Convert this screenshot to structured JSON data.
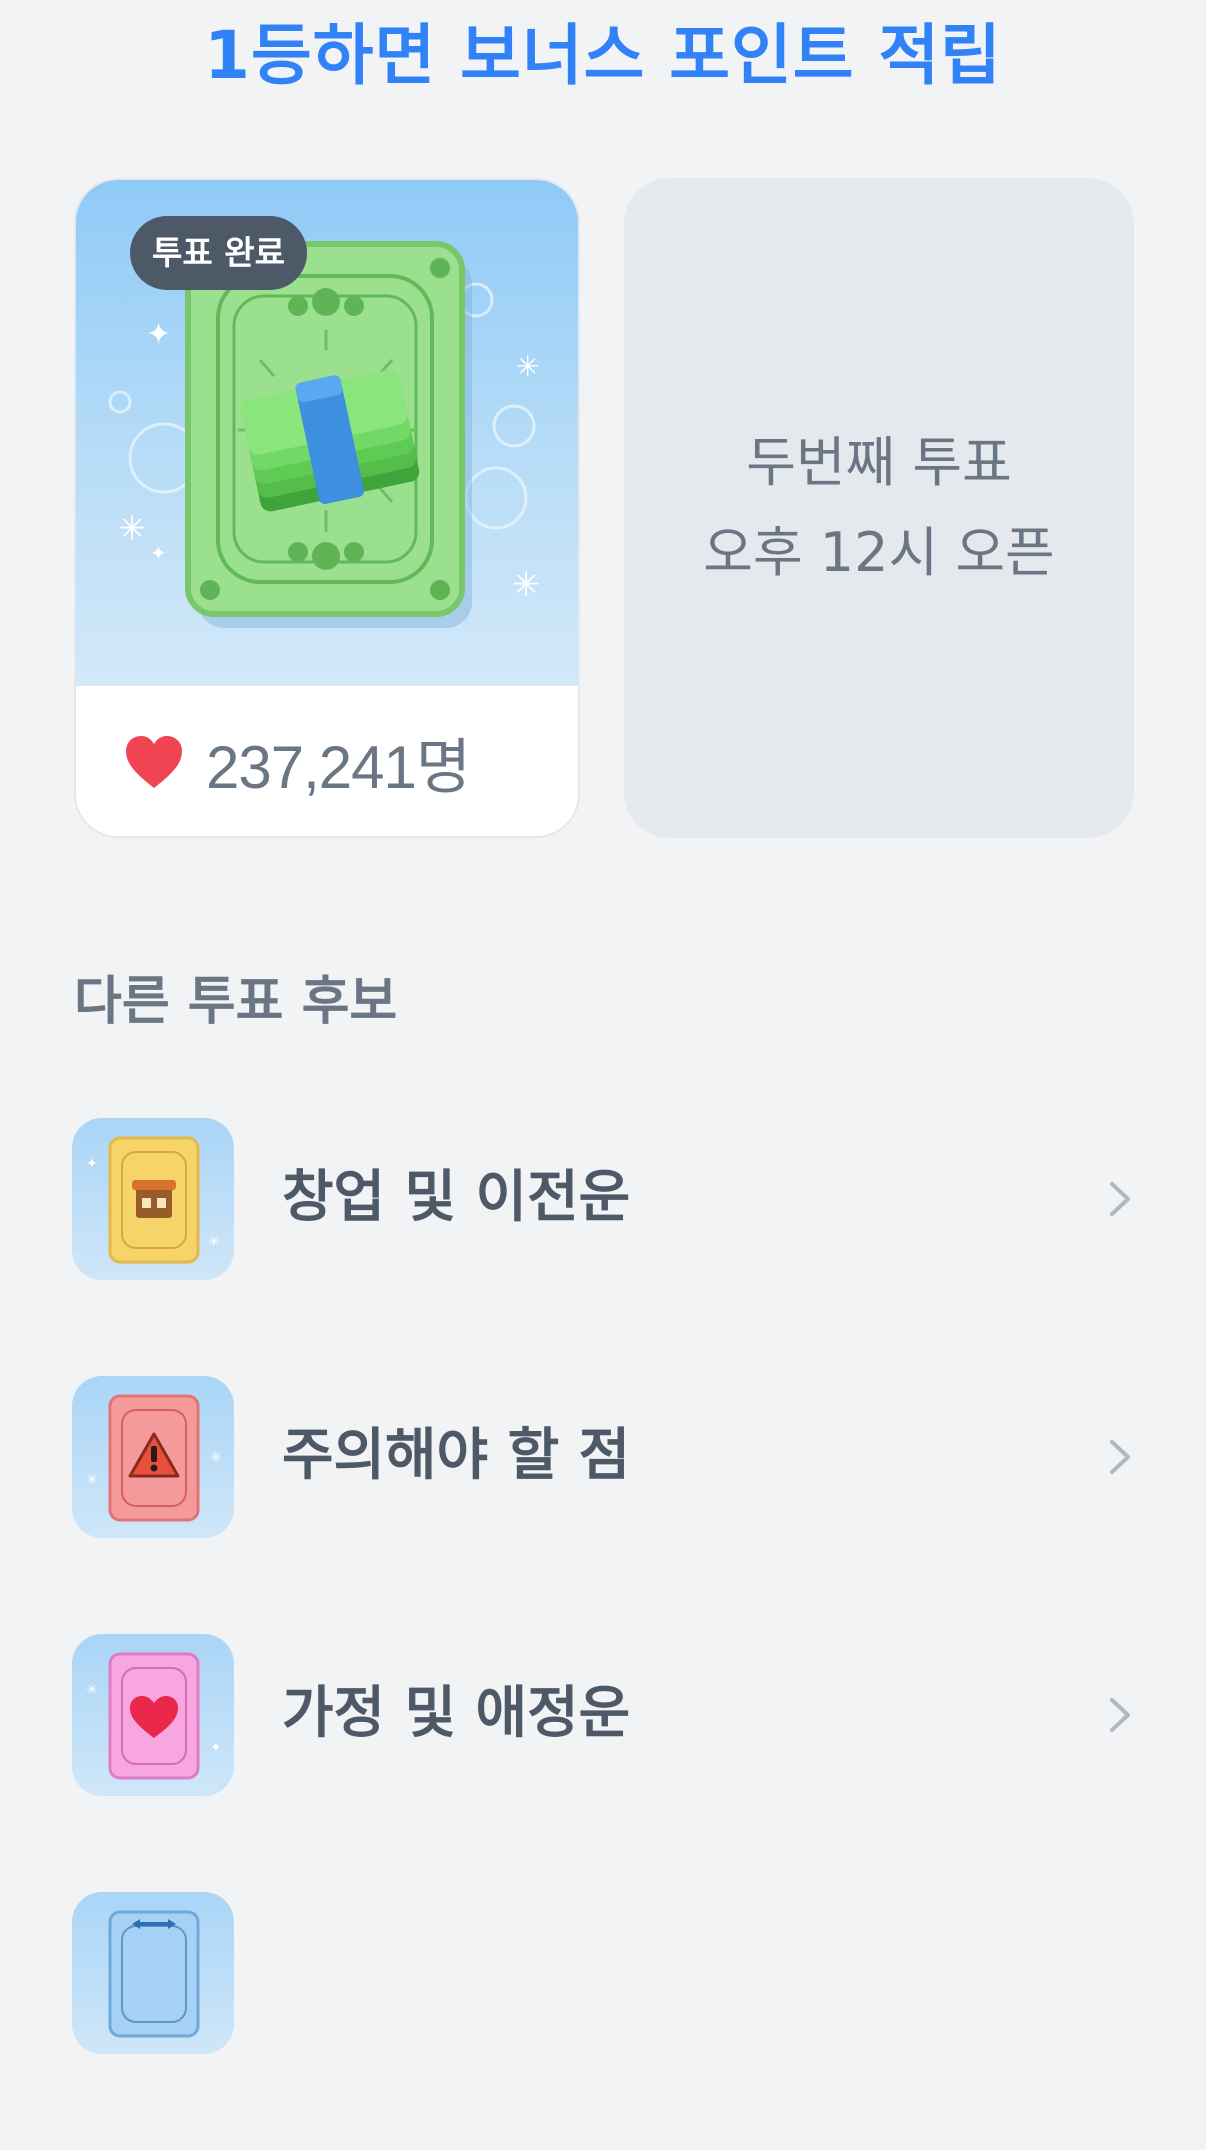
{
  "header": {
    "title": "1등하면 보너스 포인트 적립",
    "title_color": "#3182f6"
  },
  "vote_cards": {
    "completed": {
      "badge": "투표 완료",
      "count": "237,241명",
      "heart_color": "#f04452",
      "art_icon": "money-bundle-card-icon"
    },
    "next": {
      "line1": "두번째 투표",
      "line2": "오후 12시 오픈"
    }
  },
  "other_candidates": {
    "title": "다른 투표 후보",
    "items": [
      {
        "label": "창업 및 이전운",
        "icon": "shop-card-icon",
        "card_color": "#f7d46a"
      },
      {
        "label": "주의해야 할 점",
        "icon": "warning-card-icon",
        "card_color": "#f58a8a"
      },
      {
        "label": "가정 및 애정운",
        "icon": "heart-card-icon",
        "card_color": "#f59ad6"
      },
      {
        "label": "",
        "icon": "arrows-card-icon",
        "card_color": "#8fc3f2"
      }
    ]
  }
}
